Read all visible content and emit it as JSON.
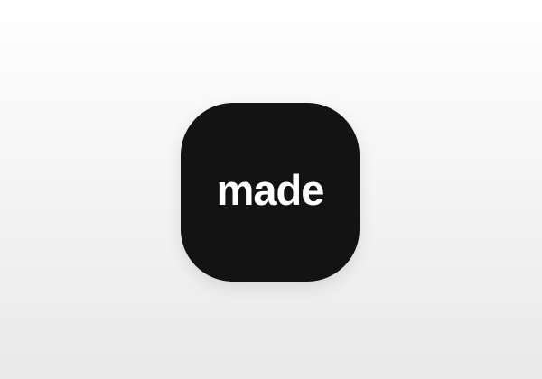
{
  "app_icon": {
    "label": "made",
    "icon_name": "made-app-icon",
    "background_color": "#131313",
    "text_color": "#ffffff"
  },
  "page": {
    "background_top_color": "#ffffff",
    "background_bottom_color": "#e9e9e9"
  }
}
